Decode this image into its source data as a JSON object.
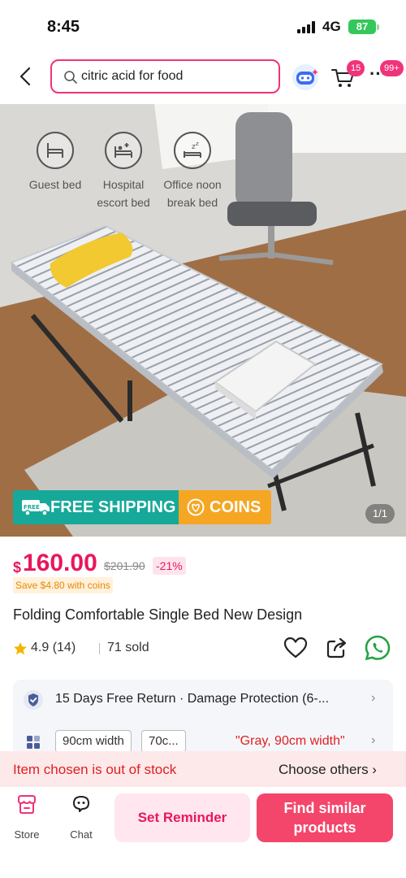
{
  "status_bar": {
    "time": "8:45",
    "network": "4G",
    "battery": "87"
  },
  "header": {
    "search_value": "citric acid for food",
    "cart_count": "15",
    "messages_count": "99+"
  },
  "gallery": {
    "features": [
      {
        "icon": "bed-icon",
        "label_line1": "Guest bed",
        "label_line2": ""
      },
      {
        "icon": "hospital-bed-icon",
        "label_line1": "Hospital",
        "label_line2": "escort bed"
      },
      {
        "icon": "nap-icon",
        "label_line1": "Office noon",
        "label_line2": "break bed"
      }
    ],
    "shipping_badge": "FREE SHIPPING",
    "shipping_badge_tag": "FREE",
    "coins_badge": "COINS",
    "page_indicator": "1/1",
    "colors": {
      "shipping": "#16a99a",
      "coins": "#f5a623"
    }
  },
  "price": {
    "symbol": "$",
    "current": "160.00",
    "original": "$201.90",
    "discount": "-21%",
    "coins_save": "Save $4.80 with coins"
  },
  "product": {
    "title": "Folding Comfortable Single Bed New Design",
    "rating": "4.9 (14)",
    "sold": "71 sold"
  },
  "info": {
    "return_policy": "15 Days Free Return · Damage Protection (6-...",
    "variants": [
      "90cm width",
      "70c..."
    ],
    "selected_variant": "\"Gray, 90cm width\""
  },
  "stock_notice": {
    "message": "Item chosen is out of stock",
    "action": "Choose others"
  },
  "bottom_nav": {
    "store_label": "Store",
    "chat_label": "Chat",
    "reminder_label": "Set Reminder",
    "similar_line1": "Find similar",
    "similar_line2": "products"
  },
  "theme": {
    "accent": "#f0337a",
    "price": "#e8175d",
    "error": "#e02020"
  }
}
